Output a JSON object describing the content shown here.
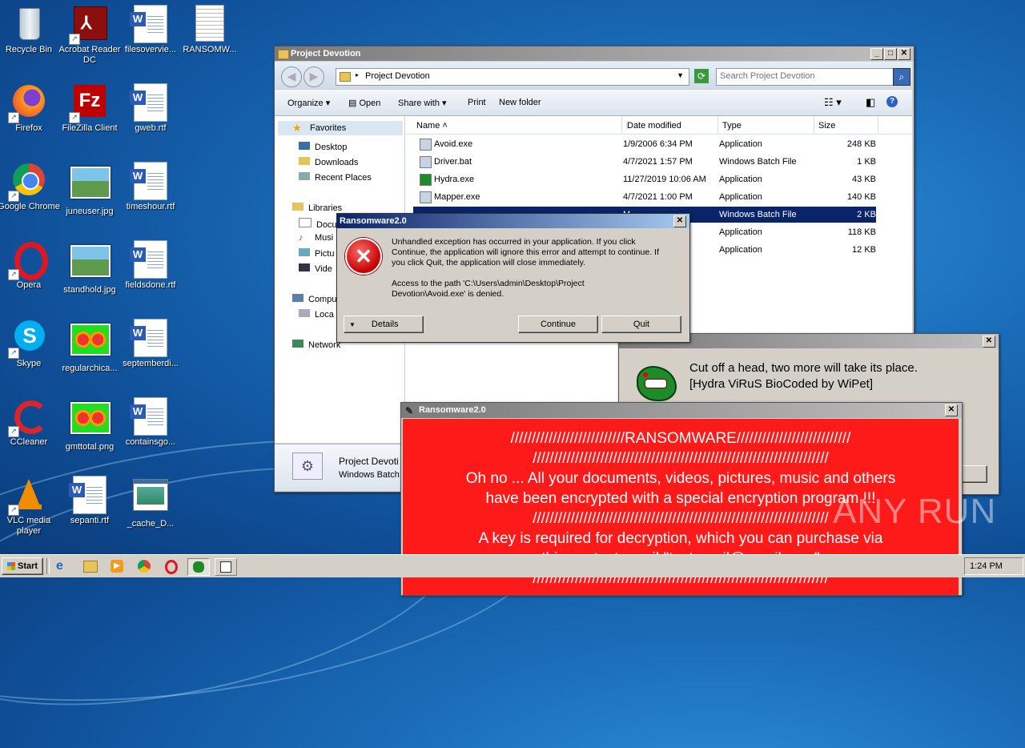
{
  "desktop_icons": [
    {
      "label": "Recycle Bin"
    },
    {
      "label": "Acrobat Reader DC"
    },
    {
      "label": "filesovervie..."
    },
    {
      "label": "RANSOMW..."
    },
    {
      "label": "Firefox"
    },
    {
      "label": "FileZilla Client"
    },
    {
      "label": "gweb.rtf"
    },
    {
      "label": "Google Chrome"
    },
    {
      "label": "juneuser.jpg"
    },
    {
      "label": "timeshour.rtf"
    },
    {
      "label": "Opera"
    },
    {
      "label": "standhold.jpg"
    },
    {
      "label": "fieldsdone.rtf"
    },
    {
      "label": "Skype"
    },
    {
      "label": "regularchica..."
    },
    {
      "label": "septemberdi..."
    },
    {
      "label": "CCleaner"
    },
    {
      "label": "gmttotal.png"
    },
    {
      "label": "containsgo..."
    },
    {
      "label": "VLC media player"
    },
    {
      "label": "sepanti.rtf"
    },
    {
      "label": "_cache_D..."
    }
  ],
  "explorer": {
    "title": "Project Devotion",
    "address": "Project Devotion",
    "search_placeholder": "Search Project Devotion",
    "toolbar": {
      "organize": "Organize",
      "open": "Open",
      "share": "Share with",
      "print": "Print",
      "new_folder": "New folder"
    },
    "nav": {
      "favorites": "Favorites",
      "desktop": "Desktop",
      "downloads": "Downloads",
      "recent": "Recent Places",
      "libraries": "Libraries",
      "documents": "Docu",
      "music": "Musi",
      "pictures": "Pictu",
      "videos": "Vide",
      "computer": "Compu",
      "local": "Loca",
      "network": "Network"
    },
    "columns": {
      "name": "Name",
      "date": "Date modified",
      "type": "Type",
      "size": "Size"
    },
    "files": [
      {
        "name": "Avoid.exe",
        "date": "1/9/2006 6:34 PM",
        "type": "Application",
        "size": "248 KB"
      },
      {
        "name": "Driver.bat",
        "date": "4/7/2021 1:57 PM",
        "type": "Windows Batch File",
        "size": "1 KB"
      },
      {
        "name": "Hydra.exe",
        "date": "11/27/2019 10:06 AM",
        "type": "Application",
        "size": "43 KB"
      },
      {
        "name": "Mapper.exe",
        "date": "4/7/2021 1:00 PM",
        "type": "Application",
        "size": "140 KB"
      },
      {
        "name": "",
        "date": "M",
        "type": "Windows Batch File",
        "size": "2 KB"
      },
      {
        "name": "",
        "date": "PM",
        "type": "Application",
        "size": "118 KB"
      },
      {
        "name": "",
        "date": "PM",
        "type": "Application",
        "size": "12 KB"
      }
    ],
    "details_name": "Project Devoti",
    "details_type": "Windows Batch I"
  },
  "error_dialog": {
    "title": "Ransomware2.0",
    "message": "Unhandled exception has occurred in your application. If you click Continue, the application will ignore this error and attempt to continue. If you click Quit, the application will close immediately.",
    "detail": "Access to the path 'C:\\Users\\admin\\Desktop\\Project Devotion\\Avoid.exe' is denied.",
    "details_btn": "Details",
    "continue_btn": "Continue",
    "quit_btn": "Quit"
  },
  "hydra_window": {
    "line1": "Cut off a head, two more will take its place.",
    "line2": "[Hydra ViRuS BioCoded by WiPet]"
  },
  "ransom_window": {
    "title": "Ransomware2.0",
    "lines": [
      "///////////////////////////RANSOMWARE///////////////////////////",
      "//////////////////////////////////////////////////////////////////////",
      "Oh no ... All your documents, videos, pictures, music and others",
      "have been encrypted with a special encryption program !!!",
      "//////////////////////////////////////////////////////////////////////",
      "A key is required for decryption, which you can purchase via",
      "this contact email \"testemail@gmail.com\"",
      "//////////////////////////////////////////////////////////////////////"
    ]
  },
  "watermark": "ANY RUN",
  "taskbar": {
    "start": "Start",
    "clock": "1:24 PM"
  },
  "colors": {
    "ransom_bg": "#ff1a1a",
    "selection": "#0a246a"
  }
}
